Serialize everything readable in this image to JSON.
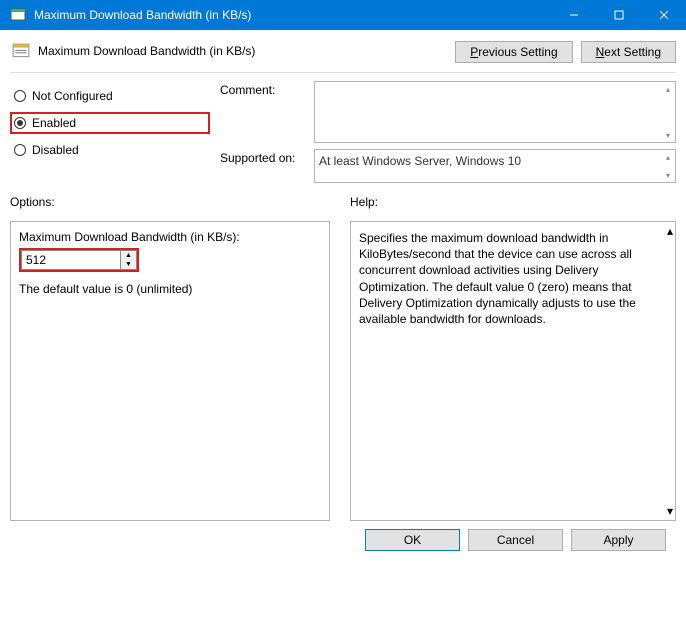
{
  "window": {
    "title": "Maximum Download Bandwidth (in KB/s)"
  },
  "header": {
    "title": "Maximum Download Bandwidth (in KB/s)",
    "prev_button": "Previous Setting",
    "next_button": "Next Setting"
  },
  "radios": {
    "not_configured": "Not Configured",
    "enabled": "Enabled",
    "disabled": "Disabled",
    "selected": "enabled"
  },
  "labels": {
    "comment": "Comment:",
    "supported": "Supported on:",
    "options": "Options:",
    "help": "Help:"
  },
  "comment_value": "",
  "supported_value": "At least Windows Server, Windows 10",
  "options": {
    "field_label": "Maximum Download Bandwidth (in KB/s):",
    "value": "512",
    "note": "The default value is 0 (unlimited)"
  },
  "help_text": "Specifies the maximum download bandwidth in KiloBytes/second that the device can use across all concurrent download activities using Delivery Optimization. The default value 0 (zero) means that Delivery Optimization dynamically adjusts to use the available bandwidth for downloads.",
  "footer": {
    "ok": "OK",
    "cancel": "Cancel",
    "apply": "Apply"
  }
}
